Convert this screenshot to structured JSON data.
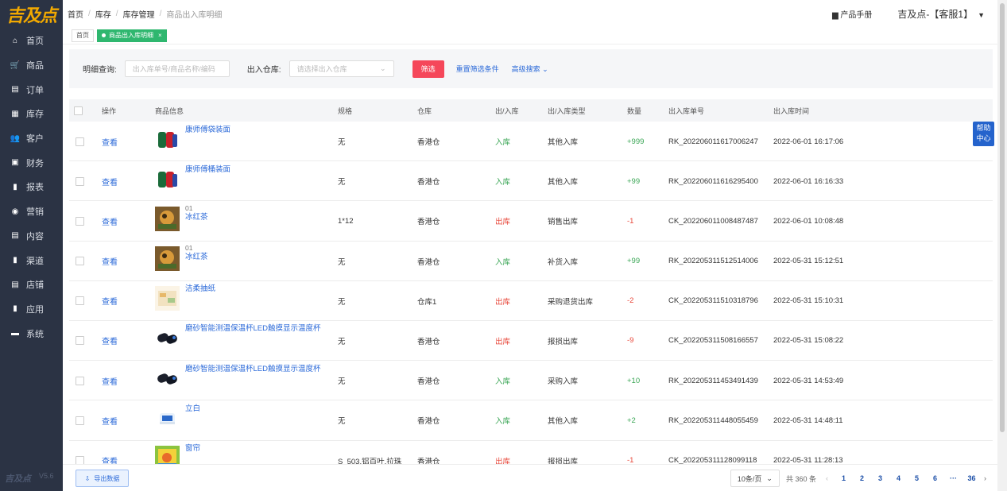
{
  "logo": "吉及点",
  "sidebar": {
    "items": [
      {
        "label": "首页",
        "icon": "home-icon",
        "glyph": "⌂"
      },
      {
        "label": "商品",
        "icon": "cart-icon",
        "glyph": "🛒"
      },
      {
        "label": "订单",
        "icon": "order-icon",
        "glyph": "▤"
      },
      {
        "label": "库存",
        "icon": "grid-icon",
        "glyph": "▦"
      },
      {
        "label": "客户",
        "icon": "users-icon",
        "glyph": "👥"
      },
      {
        "label": "财务",
        "icon": "wallet-icon",
        "glyph": "▣"
      },
      {
        "label": "报表",
        "icon": "bar-chart-icon",
        "glyph": "▮"
      },
      {
        "label": "营销",
        "icon": "target-icon",
        "glyph": "◉"
      },
      {
        "label": "内容",
        "icon": "document-icon",
        "glyph": "▤"
      },
      {
        "label": "渠道",
        "icon": "bar-chart-icon",
        "glyph": "▮"
      },
      {
        "label": "店铺",
        "icon": "store-icon",
        "glyph": "▤"
      },
      {
        "label": "应用",
        "icon": "bar-chart-icon",
        "glyph": "▮"
      },
      {
        "label": "系统",
        "icon": "monitor-icon",
        "glyph": "▬"
      }
    ],
    "footer_brand": "吉及点",
    "version": "V5.6"
  },
  "breadcrumb": [
    "首页",
    "库存",
    "库存管理",
    "商品出入库明细"
  ],
  "header": {
    "manual": "产品手册",
    "user": "吉及点-【客服1】"
  },
  "tabs": [
    {
      "label": "首页",
      "active": false
    },
    {
      "label": "商品出入库明细",
      "active": true
    }
  ],
  "filter": {
    "detail_label": "明细查询:",
    "detail_placeholder": "出入库单号/商品名称/编码",
    "warehouse_label": "出入仓库:",
    "warehouse_placeholder": "请选择出入仓库",
    "search_btn": "筛选",
    "reset": "重置筛选条件",
    "advanced": "高级搜索"
  },
  "columns": [
    "操作",
    "商品信息",
    "规格",
    "仓库",
    "出/入库",
    "出/入库类型",
    "数量",
    "出入库单号",
    "出入库时间"
  ],
  "rows": [
    {
      "action": "查看",
      "name": "康师傅袋装面",
      "sku": "",
      "spec": "无",
      "warehouse": "香港仓",
      "dir": "入库",
      "type": "其他入库",
      "qty": "+999",
      "no": "RK_202206011617006247",
      "time": "2022-06-01 16:17:06",
      "thumb": "cans"
    },
    {
      "action": "查看",
      "name": "康师傅桶装面",
      "sku": "",
      "spec": "无",
      "warehouse": "香港仓",
      "dir": "入库",
      "type": "其他入库",
      "qty": "+99",
      "no": "RK_202206011616295400",
      "time": "2022-06-01 16:16:33",
      "thumb": "cans"
    },
    {
      "action": "查看",
      "name": "冰红茶",
      "sku": "01",
      "spec": "1*12",
      "warehouse": "香港仓",
      "dir": "出库",
      "type": "销售出库",
      "qty": "-1",
      "no": "CK_202206011008487487",
      "time": "2022-06-01 10:08:48",
      "thumb": "tea"
    },
    {
      "action": "查看",
      "name": "冰红茶",
      "sku": "01",
      "spec": "无",
      "warehouse": "香港仓",
      "dir": "入库",
      "type": "补货入库",
      "qty": "+99",
      "no": "RK_202205311512514006",
      "time": "2022-05-31 15:12:51",
      "thumb": "tea"
    },
    {
      "action": "查看",
      "name": "洁柔抽纸",
      "sku": "",
      "spec": "无",
      "warehouse": "仓库1",
      "dir": "出库",
      "type": "采购退货出库",
      "qty": "-2",
      "no": "CK_202205311510318796",
      "time": "2022-05-31 15:10:31",
      "thumb": "tissue"
    },
    {
      "action": "查看",
      "name": "磨砂智能测温保温杯LED触摸显示温度杯",
      "sku": "",
      "spec": "无",
      "warehouse": "香港仓",
      "dir": "出库",
      "type": "报损出库",
      "qty": "-9",
      "no": "CK_202205311508166557",
      "time": "2022-05-31 15:08:22",
      "thumb": "cup"
    },
    {
      "action": "查看",
      "name": "磨砂智能测温保温杯LED触摸显示温度杯",
      "sku": "",
      "spec": "无",
      "warehouse": "香港仓",
      "dir": "入库",
      "type": "采购入库",
      "qty": "+10",
      "no": "RK_202205311453491439",
      "time": "2022-05-31 14:53:49",
      "thumb": "cup"
    },
    {
      "action": "查看",
      "name": "立白",
      "sku": "",
      "spec": "无",
      "warehouse": "香港仓",
      "dir": "入库",
      "type": "其他入库",
      "qty": "+2",
      "no": "RK_202205311448055459",
      "time": "2022-05-31 14:48:11",
      "thumb": "detergent"
    },
    {
      "action": "查看",
      "name": "窗帘",
      "sku": "",
      "spec": "S_503,铝百叶,拉珠",
      "warehouse": "香港仓",
      "dir": "出库",
      "type": "报损出库",
      "qty": "-1",
      "no": "CK_202205311128099118",
      "time": "2022-05-31 11:28:13",
      "thumb": "curtain"
    }
  ],
  "bottom": {
    "export": "导出数据",
    "page_size": "10条/页",
    "total": "共 360 条",
    "pages": [
      "1",
      "2",
      "3",
      "4",
      "5",
      "6",
      "···",
      "36"
    ]
  },
  "help": [
    "帮助",
    "中心"
  ]
}
